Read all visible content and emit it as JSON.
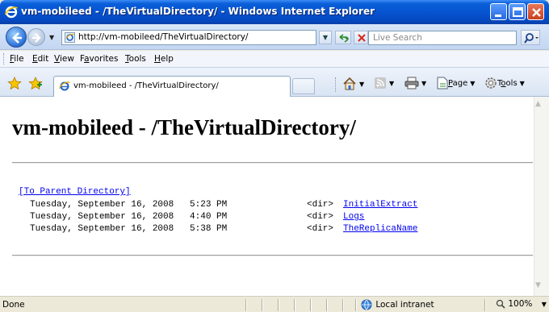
{
  "window": {
    "title": "vm-mobileed - /TheVirtualDirectory/ - Windows Internet Explorer"
  },
  "address_bar": {
    "url": "http://vm-mobileed/TheVirtualDirectory/",
    "search_placeholder": "Live Search"
  },
  "menu": [
    {
      "label": "File",
      "accel": "F"
    },
    {
      "label": "Edit",
      "accel": "E"
    },
    {
      "label": "View",
      "accel": "V"
    },
    {
      "label": "Favorites",
      "accel": "a"
    },
    {
      "label": "Tools",
      "accel": "T"
    },
    {
      "label": "Help",
      "accel": "H"
    }
  ],
  "tab": {
    "label": "vm-mobileed - /TheVirtualDirectory/"
  },
  "command_bar": {
    "page_label": "Page",
    "tools_label": "Tools"
  },
  "page": {
    "heading": "vm-mobileed - /TheVirtualDirectory/",
    "parent_link": "[To Parent Directory]",
    "entries": [
      {
        "date": "Tuesday, September 16, 2008",
        "time": "5:23 PM",
        "type": "<dir>",
        "name": "InitialExtract"
      },
      {
        "date": "Tuesday, September 16, 2008",
        "time": "4:40 PM",
        "type": "<dir>",
        "name": "Logs"
      },
      {
        "date": "Tuesday, September 16, 2008",
        "time": "5:38 PM",
        "type": "<dir>",
        "name": "TheReplicaName"
      }
    ]
  },
  "status_bar": {
    "status": "Done",
    "zone": "Local intranet",
    "zoom": "100%"
  },
  "colors": {
    "titlebar": "#0653d0",
    "link": "#0000ee",
    "chrome": "#ece9d8"
  }
}
